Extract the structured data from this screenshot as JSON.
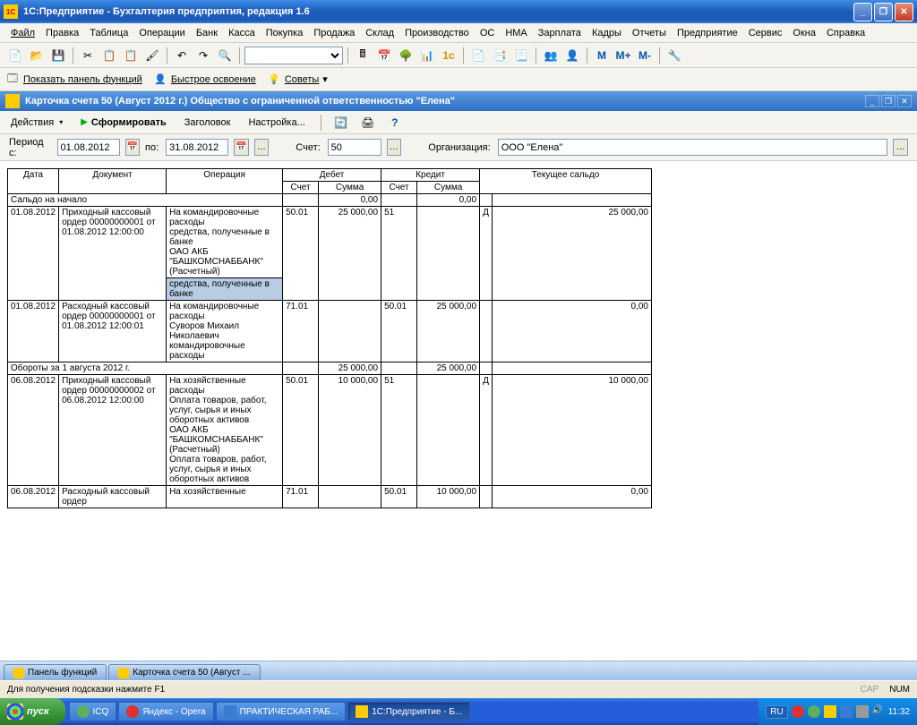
{
  "window": {
    "title": "1С:Предприятие - Бухгалтерия предприятия, редакция 1.6"
  },
  "menu": [
    "Файл",
    "Правка",
    "Таблица",
    "Операции",
    "Банк",
    "Касса",
    "Покупка",
    "Продажа",
    "Склад",
    "Производство",
    "ОС",
    "НМА",
    "Зарплата",
    "Кадры",
    "Отчеты",
    "Предприятие",
    "Сервис",
    "Окна",
    "Справка"
  ],
  "toolbar_text": {
    "m": "M",
    "m_plus": "M+",
    "m_minus": "M-"
  },
  "links": [
    {
      "label": "Показать панель функций"
    },
    {
      "label": "Быстрое освоение"
    },
    {
      "label": "Советы"
    }
  ],
  "doc": {
    "title": "Карточка счета 50 (Август 2012 г.) Общество с ограниченной ответственностью \"Елена\""
  },
  "actions": {
    "actions_label": "Действия",
    "form": "Сформировать",
    "header": "Заголовок",
    "settings": "Настройка..."
  },
  "filter": {
    "period_label": "Период с:",
    "date_from": "01.08.2012",
    "to_label": "по:",
    "date_to": "31.08.2012",
    "account_label": "Счет:",
    "account": "50",
    "org_label": "Организация:",
    "org": "ООО \"Елена\""
  },
  "table": {
    "headers": {
      "date": "Дата",
      "doc": "Документ",
      "op": "Операция",
      "debit": "Дебет",
      "credit": "Кредит",
      "balance": "Текущее сальдо",
      "acct": "Счет",
      "sum": "Сумма"
    },
    "opening": {
      "label": "Сальдо на начало",
      "d": "0,00",
      "c": "0,00"
    },
    "rows": [
      {
        "date": "01.08.2012",
        "doc": "Приходный кассовый ордер 00000000001 от 01.08.2012 12:00:00",
        "op": "На командировочные расходы\nсредства, полученные в банке\nОАО АКБ \"БАШКОМСНАББАНК\" (Расчетный)",
        "op_highlight": "средства, полученные в банке",
        "d_acct": "50.01",
        "d_sum": "25 000,00",
        "c_acct": "51",
        "c_sum": "",
        "bal_dc": "Д",
        "bal": "25 000,00"
      },
      {
        "date": "01.08.2012",
        "doc": "Расходный кассовый ордер 00000000001 от 01.08.2012 12:00:01",
        "op": "На командировочные расходы\nСуворов Михаил Николаевич командировочные расходы",
        "d_acct": "71.01",
        "d_sum": "",
        "c_acct": "50.01",
        "c_sum": "25 000,00",
        "bal_dc": "",
        "bal": "0,00"
      }
    ],
    "turnover1": {
      "label": "Обороты за 1 августа 2012 г.",
      "d": "25 000,00",
      "c": "25 000,00"
    },
    "rows2": [
      {
        "date": "06.08.2012",
        "doc": "Приходный кассовый ордер 00000000002 от 06.08.2012 12:00:00",
        "op": "На хозяйственные расходы\nОплата товаров, работ, услуг, сырья и иных оборотных активов\nОАО АКБ \"БАШКОМСНАББАНК\" (Расчетный)\nОплата товаров, работ, услуг, сырья и иных оборотных активов",
        "d_acct": "50.01",
        "d_sum": "10 000,00",
        "c_acct": "51",
        "c_sum": "",
        "bal_dc": "Д",
        "bal": "10 000,00"
      },
      {
        "date": "06.08.2012",
        "doc": "Расходный кассовый ордер",
        "op": "На хозяйственные",
        "d_acct": "71.01",
        "d_sum": "",
        "c_acct": "50.01",
        "c_sum": "10 000,00",
        "bal_dc": "",
        "bal": "0,00"
      }
    ]
  },
  "tabs": [
    {
      "label": "Панель функций"
    },
    {
      "label": "Карточка счета 50 (Август ..."
    }
  ],
  "statusbar": {
    "hint": "Для получения подсказки нажмите F1",
    "cap": "CAP",
    "num": "NUM"
  },
  "taskbar": {
    "start": "пуск",
    "items": [
      {
        "label": "ICQ",
        "color": "#5faf5f"
      },
      {
        "label": "Яндекс - Opera",
        "color": "#e03030"
      },
      {
        "label": "ПРАКТИЧЕСКАЯ РАБ...",
        "color": "#3a7cd5"
      },
      {
        "label": "1С:Предприятие - Б...",
        "color": "#ffcc00",
        "active": true
      }
    ],
    "lang": "RU",
    "time": "11:32"
  }
}
